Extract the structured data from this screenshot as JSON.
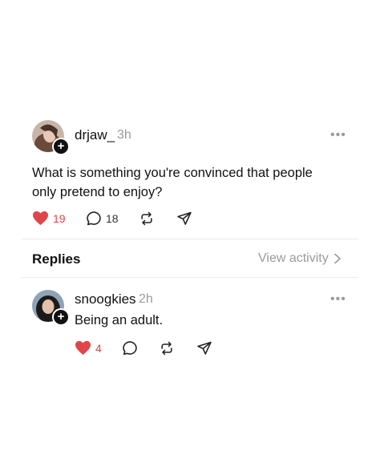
{
  "post": {
    "username": "drjaw_",
    "time": "3h",
    "text_line1": "What is something you're convinced that people",
    "text_line2": "only pretend to enjoy?",
    "likes": "19",
    "comments": "18",
    "more_label": "•••"
  },
  "replies_header": {
    "label": "Replies",
    "view_activity": "View activity"
  },
  "reply": {
    "username": "snoogkies",
    "time": "2h",
    "text": "Being an adult.",
    "likes": "4",
    "more_label": "•••"
  },
  "icons": {
    "like": "heart-filled-icon",
    "comment": "comment-icon",
    "repost": "repost-icon",
    "share": "send-icon",
    "follow": "plus-icon",
    "view_activity": "chevron-right-icon"
  },
  "colors": {
    "like": "#e0454a",
    "muted": "#9a9a9a",
    "divider": "#ececec"
  },
  "plus_glyph": "+"
}
